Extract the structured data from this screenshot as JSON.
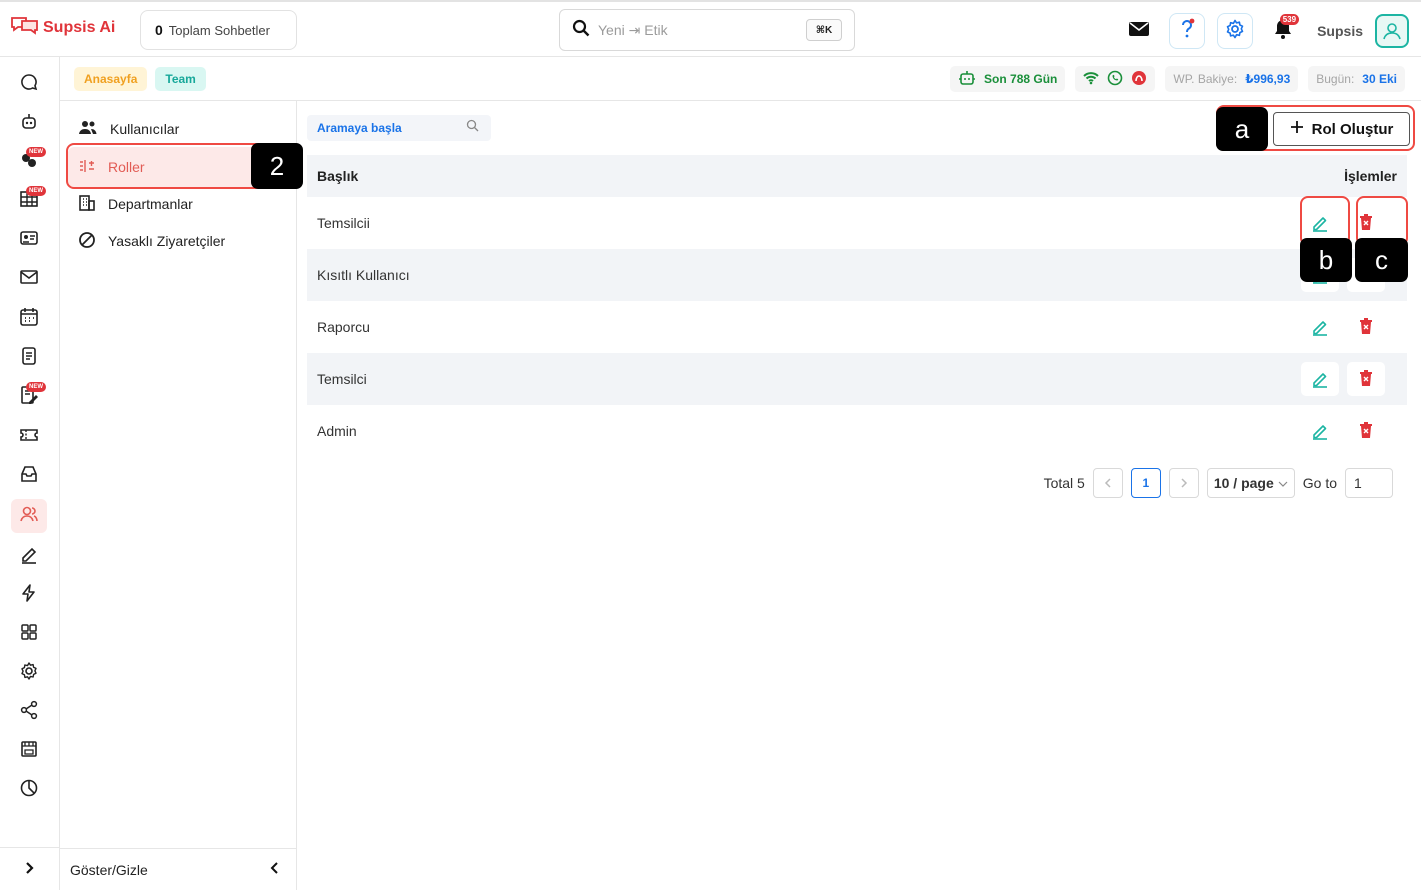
{
  "app": {
    "name": "Supsis Ai"
  },
  "header": {
    "total_chats_count": "0",
    "total_chats_label": "Toplam Sohbetler",
    "search_placeholder": "Yeni ⇥ Etik",
    "search_shortcut": "⌘K",
    "notification_count": "539",
    "user_name": "Supsis"
  },
  "tabs": [
    {
      "label": "Anasayfa"
    },
    {
      "label": "Team"
    }
  ],
  "stats": {
    "days": "Son 788 Gün",
    "balance_label": "WP. Bakiye:",
    "balance_value": "₺996,93",
    "today_label": "Bugün:",
    "today_value": "30 Eki"
  },
  "subnav": {
    "items": [
      {
        "label": "Kullanıcılar",
        "icon": "users-icon"
      },
      {
        "label": "Roller",
        "icon": "roles-icon"
      },
      {
        "label": "Departmanlar",
        "icon": "building-icon"
      },
      {
        "label": "Yasaklı Ziyaretçiler",
        "icon": "ban-icon"
      }
    ],
    "footer_label": "Göster/Gizle"
  },
  "main": {
    "search_placeholder": "Aramaya başla",
    "create_button": "Rol Oluştur",
    "columns": {
      "title": "Başlık",
      "actions": "İşlemler"
    },
    "rows": [
      {
        "title": "Temsilcii"
      },
      {
        "title": "Kısıtlı Kullanıcı"
      },
      {
        "title": "Raporcu"
      },
      {
        "title": "Temsilci"
      },
      {
        "title": "Admin"
      }
    ],
    "pagination": {
      "total": "Total 5",
      "current_page": "1",
      "page_size": "10 / page",
      "goto_label": "Go to",
      "goto_value": "1"
    }
  },
  "annotations": {
    "step": "2",
    "a": "a",
    "b": "b",
    "c": "c"
  },
  "colors": {
    "accent_red": "#e0343a",
    "teal": "#1cb5a3",
    "blue": "#1a73e8",
    "annotation_red": "#ef4a43"
  }
}
